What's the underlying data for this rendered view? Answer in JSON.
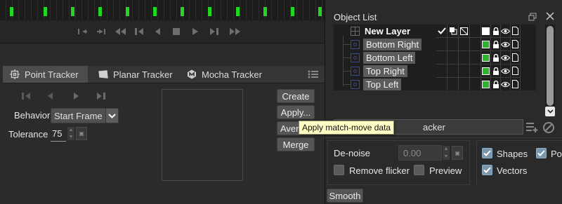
{
  "timeline": {
    "keyframe_color": "#23d823"
  },
  "transport": {
    "buttons": [
      "go-to-in-icon",
      "go-to-out-icon",
      "step-back-many-icon",
      "step-back-keyframe-icon",
      "step-back-icon",
      "stop-icon",
      "play-icon",
      "step-forward-keyframe-icon",
      "step-forward-many-icon"
    ]
  },
  "tracker": {
    "tabs": [
      {
        "label": "Point Tracker",
        "icon": "point-tracker-icon",
        "active": true
      },
      {
        "label": "Planar Tracker",
        "icon": "planar-tracker-icon",
        "active": false
      },
      {
        "label": "Mocha Tracker",
        "icon": "mocha-icon",
        "active": false
      }
    ],
    "behavior_label": "Behavior",
    "behavior_value": "Start Frame",
    "tolerance_label": "Tolerance",
    "tolerance_value": "75",
    "buttons": {
      "create": "Create",
      "apply": "Apply...",
      "average": "Aver",
      "merge": "Merge"
    },
    "tooltip": "Apply match-move data"
  },
  "object_list": {
    "title": "Object List",
    "group": {
      "name": "New Layer"
    },
    "layers": [
      {
        "name": "Bottom Right"
      },
      {
        "name": "Bottom Left"
      },
      {
        "name": "Top Right"
      },
      {
        "name": "Top Left"
      }
    ],
    "layer_field_value": "acker"
  },
  "lower": {
    "denoise_label": "De-noise",
    "denoise_value": "0.00",
    "remove_flicker_label": "Remove flicker",
    "remove_flicker_checked": false,
    "preview_label": "Preview",
    "preview_checked": false,
    "smooth_label": "Smooth",
    "shapes_label": "Shapes",
    "shapes_checked": true,
    "points_label": "Poi",
    "points_checked": true,
    "vectors_label": "Vectors",
    "vectors_checked": true
  },
  "colors": {
    "accent_green": "#2cb52c",
    "tooltip_bg": "#fffec4",
    "checkbox_on": "#7a98ad"
  }
}
